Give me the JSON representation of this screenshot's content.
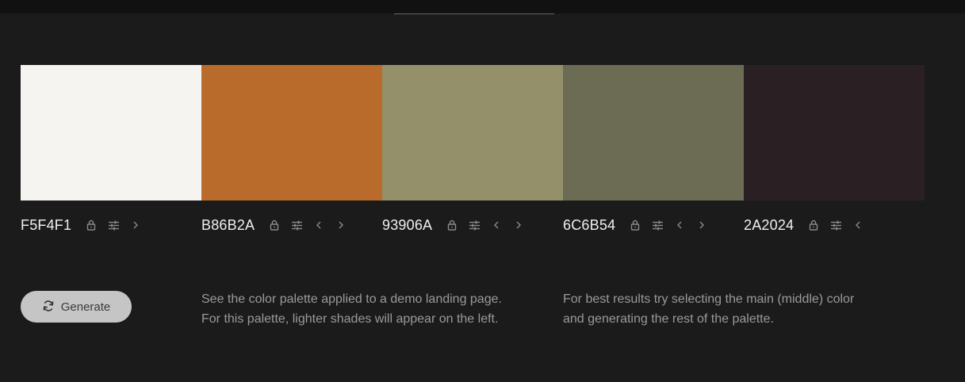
{
  "colors": [
    {
      "hex": "F5F4F1",
      "swatch": "#F5F4F1",
      "has_prev": false,
      "has_next": true
    },
    {
      "hex": "B86B2A",
      "swatch": "#B86B2A",
      "has_prev": true,
      "has_next": true
    },
    {
      "hex": "93906A",
      "swatch": "#93906A",
      "has_prev": true,
      "has_next": true
    },
    {
      "hex": "6C6B54",
      "swatch": "#6C6B54",
      "has_prev": true,
      "has_next": true
    },
    {
      "hex": "2A2024",
      "swatch": "#2A2024",
      "has_prev": true,
      "has_next": false
    }
  ],
  "icons": {
    "lock": "lock-icon",
    "adjust": "sliders-icon",
    "prev": "chevron-left-icon",
    "next": "chevron-right-icon",
    "generate": "refresh-icon"
  },
  "actions": {
    "generate_label": "Generate"
  },
  "info": {
    "demo_line1": "See the color palette applied to a demo landing page.",
    "demo_line2": "For this palette, lighter shades will appear on the left.",
    "tip_line1": "For best results try selecting the main (middle) color",
    "tip_line2": "and generating the rest of the palette."
  },
  "theme": {
    "background": "#1b1b1b",
    "icon_color": "#8a8a8a",
    "button_bg": "#c5c5c5"
  }
}
